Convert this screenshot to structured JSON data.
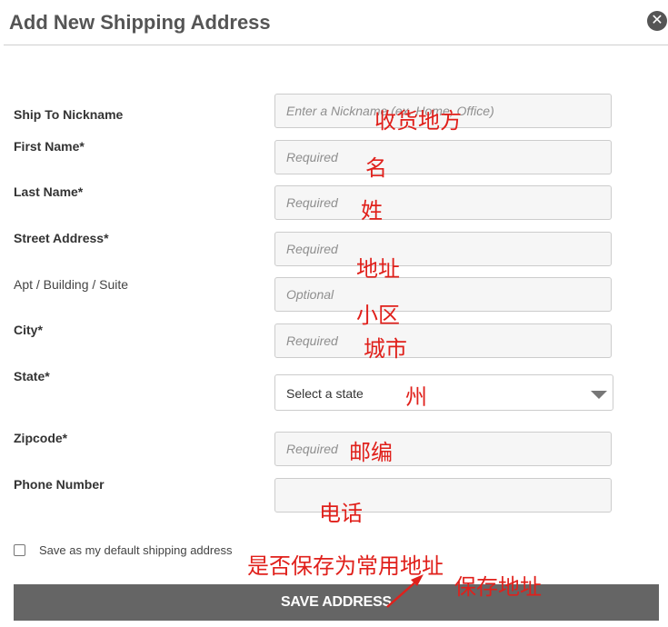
{
  "dialog": {
    "title": "Add New Shipping Address",
    "close_glyph": "✕"
  },
  "form": {
    "fields": [
      {
        "label": "Ship To Nickname",
        "placeholder": "Enter a Nickname (ex. Home, Office)",
        "value": ""
      },
      {
        "label": "First Name*",
        "placeholder": "Required",
        "value": ""
      },
      {
        "label": "Last Name*",
        "placeholder": "Required",
        "value": ""
      },
      {
        "label": "Street Address*",
        "placeholder": "Required",
        "value": ""
      },
      {
        "label": "Apt / Building / Suite",
        "placeholder": "Optional",
        "value": ""
      },
      {
        "label": "City*",
        "placeholder": "Required",
        "value": ""
      },
      {
        "label": "Zipcode*",
        "placeholder": "Required",
        "value": ""
      },
      {
        "label": "Phone Number",
        "placeholder": "",
        "value": ""
      }
    ],
    "state": {
      "label": "State*",
      "selected": "Select a state"
    },
    "default_checkbox": {
      "label": "Save as my default shipping address",
      "checked": false
    },
    "save_button": "SAVE ADDRESS"
  },
  "annotations": {
    "nickname": "收货地方",
    "first_name": "名",
    "last_name": "姓",
    "street": "地址",
    "apt": "小区",
    "city": "城市",
    "state": "州",
    "zipcode": "邮编",
    "phone": "电话",
    "default": "是否保存为常用地址",
    "save": "保存地址",
    "color": "#e0201b"
  },
  "icons": {
    "close": "close-icon",
    "dropdown": "chevron-down-icon",
    "arrow": "annotation-arrow-icon"
  }
}
